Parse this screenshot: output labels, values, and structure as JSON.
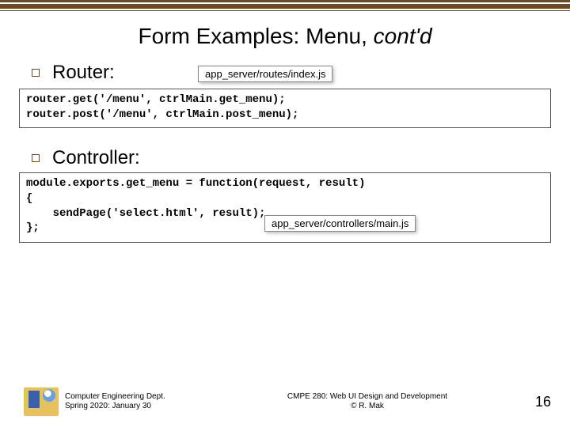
{
  "title_plain": "Form Examples: Menu, ",
  "title_italic": "cont'd",
  "sections": {
    "router": {
      "heading": "Router:",
      "path": "app_server/routes/index.js",
      "code": "router.get('/menu', ctrlMain.get_menu);\nrouter.post('/menu', ctrlMain.post_menu);"
    },
    "controller": {
      "heading": "Controller:",
      "path": "app_server/controllers/main.js",
      "code": "module.exports.get_menu = function(request, result)\n{\n    sendPage('select.html', result);\n};"
    }
  },
  "footer": {
    "dept": "Computer Engineering Dept.",
    "term": "Spring 2020: January 30",
    "course": "CMPE 280: Web UI Design and Development",
    "copyright": "© R. Mak",
    "page": "16"
  }
}
